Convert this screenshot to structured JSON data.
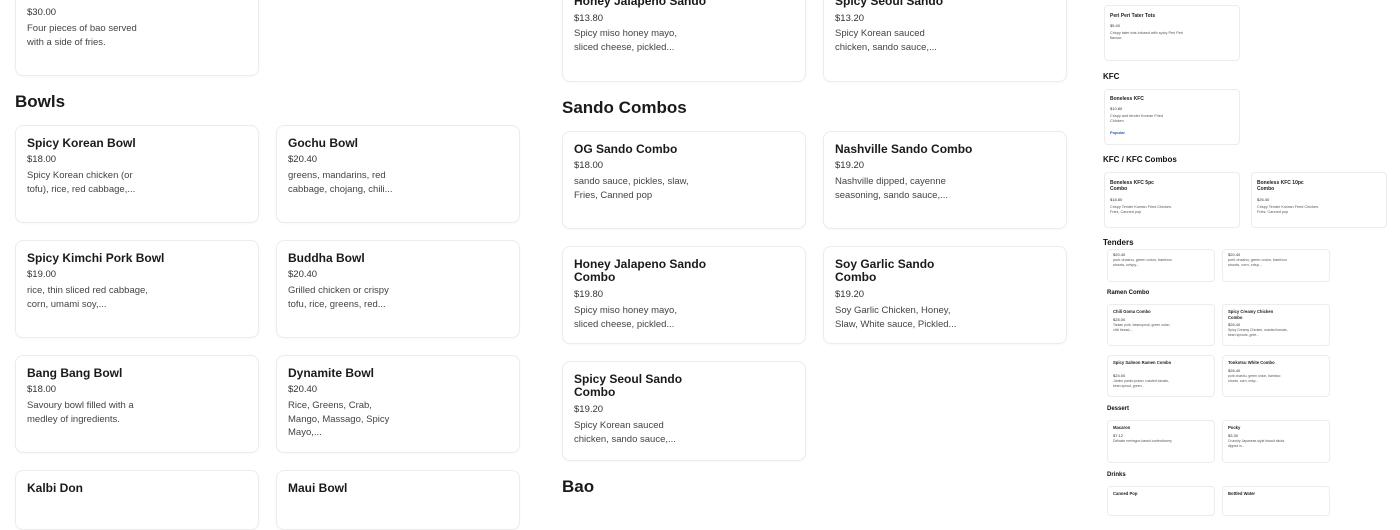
{
  "left_top_card": {
    "price": "$30.00",
    "desc": "Four pieces of bao served with a side of fries."
  },
  "bowls": {
    "title": "Bowls",
    "items": [
      {
        "name": "Spicy Korean Bowl",
        "price": "$18.00",
        "desc": "Spicy Korean chicken (or tofu), rice, red cabbage,..."
      },
      {
        "name": "Gochu Bowl",
        "price": "$20.40",
        "desc": "greens, mandarins, red cabbage, chojang, chili..."
      },
      {
        "name": "Spicy Kimchi Pork Bowl",
        "price": "$19.00",
        "desc": "rice, thin sliced red cabbage, corn, umami soy,..."
      },
      {
        "name": "Buddha Bowl",
        "price": "$20.40",
        "desc": "Grilled chicken or crispy tofu, rice, greens, red..."
      },
      {
        "name": "Bang Bang Bowl",
        "price": "$18.00",
        "desc": "Savoury bowl filled with a medley of ingredients."
      },
      {
        "name": "Dynamite Bowl",
        "price": "$20.40",
        "desc": "Rice, Greens, Crab, Mango, Massago, Spicy Mayo,..."
      },
      {
        "name": "Kalbi Don"
      },
      {
        "name": "Maui Bowl"
      }
    ]
  },
  "sandos_top": [
    {
      "name": "Honey Jalapeno Sando",
      "price": "$13.80",
      "desc": "Spicy miso honey mayo, sliced cheese, pickled..."
    },
    {
      "name": "Spicy Seoul Sando",
      "price": "$13.20",
      "desc": "Spicy Korean sauced chicken, sando sauce,..."
    }
  ],
  "sando_combos": {
    "title": "Sando Combos",
    "items": [
      {
        "name": "OG Sando Combo",
        "price": "$18.00",
        "desc": "sando sauce, pickles, slaw, Fries, Canned pop"
      },
      {
        "name": "Nashville Sando Combo",
        "price": "$19.20",
        "desc": "Nashville dipped, cayenne seasoning, sando sauce,..."
      },
      {
        "name": "Honey Jalapeno Sando Combo",
        "price": "$19.80",
        "desc": "Spicy miso honey mayo, sliced cheese, pickled..."
      },
      {
        "name": "Soy Garlic Sando Combo",
        "price": "$19.20",
        "desc": "Soy Garlic Chicken, Honey, Slaw, White sauce, Pickled..."
      },
      {
        "name": "Spicy Seoul Sando Combo",
        "price": "$19.20",
        "desc": "Spicy Korean sauced chicken, sando sauce,..."
      }
    ]
  },
  "bao_title": "Bao",
  "sidebar": {
    "top_item": {
      "name": "Peri Peri Tater Tots",
      "price": "$5.40",
      "desc": "Crispy tater tots infused with spicy Peri Peri flavour."
    },
    "kfc": {
      "title": "KFC",
      "item": {
        "name": "Boneless KFC",
        "price": "$10.80",
        "desc": "Crispy and tender Korean Fried Chicken",
        "tag": "Popular"
      }
    },
    "kfc_combos": {
      "title": "KFC / KFC Combos",
      "items": [
        {
          "name": "Boneless KFC 5pc Combo",
          "price": "$18.80",
          "desc": "Crispy Tender Korean Fried Chicken. Fries, Canned pop"
        },
        {
          "name": "Boneless KFC 10pc Combo",
          "price": "$26.40",
          "desc": "Crispy Tender Korean Fried Chicken. Fries, Canned pop"
        }
      ]
    },
    "tenders": {
      "title": "Tenders",
      "items": [
        {
          "price": "$20.40",
          "desc": "pork chashu, green onion, bamboo shoots, crispy..."
        },
        {
          "price": "$20.40",
          "desc": "pork chashu, green onion, bamboo shoots, corn, crisp..."
        }
      ]
    },
    "ramen": {
      "title": "Ramen Combo",
      "items": [
        {
          "name": "Chili Goma Combo",
          "price": "$25.00",
          "desc": "Tantan pork, beansprout, green onion, chili thread,..."
        },
        {
          "name": "Spicy Creamy Chicken Combo",
          "price": "$26.40",
          "desc": "Spicy Creamy Chicken, roasted tomato, bean sprouts, gree..."
        },
        {
          "name": "Spicy Salmon Ramen Combo",
          "price": "$24.00",
          "desc": "Jumbo panko prawn, roasted tomato, bean sprout, green..."
        },
        {
          "name": "Tonkotsu White Combo",
          "price": "$26.40",
          "desc": "pork chashu, green onion, bamboo shoots, corn, crisp..."
        }
      ]
    },
    "dessert": {
      "title": "Dessert",
      "items": [
        {
          "name": "Macaron",
          "price": "$7.12",
          "desc": "Delicate meringue-based confectionery"
        },
        {
          "name": "Pocky",
          "price": "$3.30",
          "desc": "Crunchy Japanese-style biscuit sticks dipped in..."
        }
      ]
    },
    "drinks": {
      "title": "Drinks",
      "items": [
        {
          "name": "Canned Pop"
        },
        {
          "name": "Bottled Water"
        }
      ]
    }
  }
}
